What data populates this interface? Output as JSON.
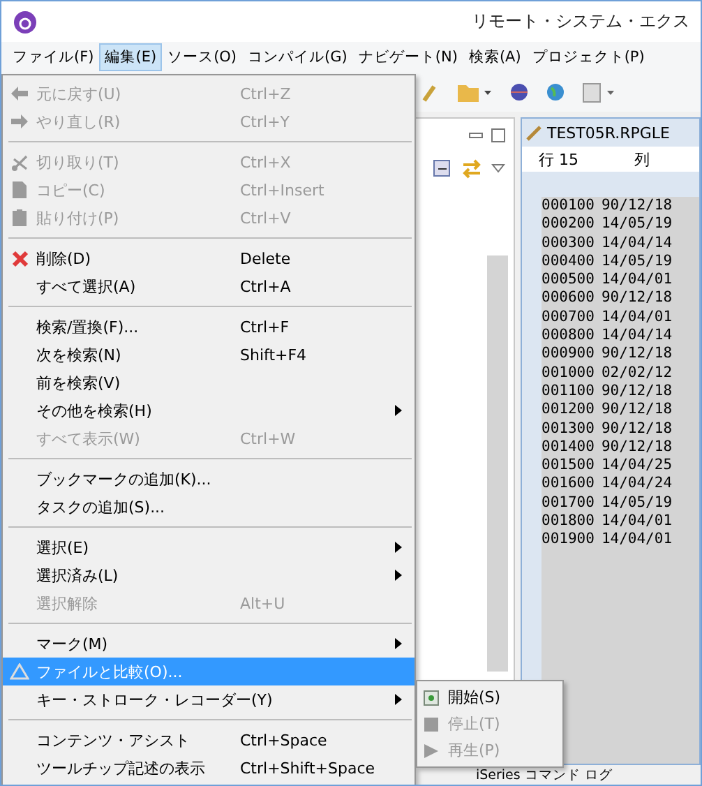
{
  "window": {
    "title": "リモート・システム・エクス"
  },
  "menubar": [
    {
      "label": "ファイル(F)",
      "selected": false
    },
    {
      "label": "編集(E)",
      "selected": true
    },
    {
      "label": "ソース(O)",
      "selected": false
    },
    {
      "label": "コンパイル(G)",
      "selected": false
    },
    {
      "label": "ナビゲート(N)",
      "selected": false
    },
    {
      "label": "検索(A)",
      "selected": false
    },
    {
      "label": "プロジェクト(P)",
      "selected": false
    }
  ],
  "edit_menu": [
    {
      "kind": "undo",
      "label": "元に戻す(U)",
      "shortcut": "Ctrl+Z",
      "disabled": true,
      "submenu": false,
      "selected": false
    },
    {
      "kind": "redo",
      "label": "やり直し(R)",
      "shortcut": "Ctrl+Y",
      "disabled": true,
      "submenu": false,
      "selected": false
    },
    {
      "kind": "separator"
    },
    {
      "kind": "cut",
      "label": "切り取り(T)",
      "shortcut": "Ctrl+X",
      "disabled": true,
      "submenu": false,
      "selected": false
    },
    {
      "kind": "copy",
      "label": "コピー(C)",
      "shortcut": "Ctrl+Insert",
      "disabled": true,
      "submenu": false,
      "selected": false
    },
    {
      "kind": "paste",
      "label": "貼り付け(P)",
      "shortcut": "Ctrl+V",
      "disabled": true,
      "submenu": false,
      "selected": false
    },
    {
      "kind": "separator"
    },
    {
      "kind": "delete",
      "label": "削除(D)",
      "shortcut": "Delete",
      "disabled": false,
      "submenu": false,
      "selected": false
    },
    {
      "kind": "item",
      "label": "すべて選択(A)",
      "shortcut": "Ctrl+A",
      "disabled": false,
      "submenu": false,
      "selected": false
    },
    {
      "kind": "separator"
    },
    {
      "kind": "item",
      "label": "検索/置換(F)...",
      "shortcut": "Ctrl+F",
      "disabled": false,
      "submenu": false,
      "selected": false
    },
    {
      "kind": "item",
      "label": "次を検索(N)",
      "shortcut": "Shift+F4",
      "disabled": false,
      "submenu": false,
      "selected": false
    },
    {
      "kind": "item",
      "label": "前を検索(V)",
      "disabled": false,
      "submenu": false,
      "selected": false
    },
    {
      "kind": "item",
      "label": "その他を検索(H)",
      "disabled": false,
      "submenu": true,
      "selected": false
    },
    {
      "kind": "item",
      "label": "すべて表示(W)",
      "shortcut": "Ctrl+W",
      "disabled": true,
      "submenu": false,
      "selected": false
    },
    {
      "kind": "separator"
    },
    {
      "kind": "item",
      "label": "ブックマークの追加(K)...",
      "disabled": false,
      "submenu": false,
      "selected": false
    },
    {
      "kind": "item",
      "label": "タスクの追加(S)...",
      "disabled": false,
      "submenu": false,
      "selected": false
    },
    {
      "kind": "separator"
    },
    {
      "kind": "item",
      "label": "選択(E)",
      "disabled": false,
      "submenu": true,
      "selected": false
    },
    {
      "kind": "item",
      "label": "選択済み(L)",
      "disabled": false,
      "submenu": true,
      "selected": false
    },
    {
      "kind": "item",
      "label": "選択解除",
      "shortcut": "Alt+U",
      "disabled": true,
      "submenu": false,
      "selected": false
    },
    {
      "kind": "separator"
    },
    {
      "kind": "item",
      "label": "マーク(M)",
      "disabled": false,
      "submenu": true,
      "selected": false
    },
    {
      "kind": "compare",
      "label": "ファイルと比較(O)...",
      "disabled": false,
      "submenu": false,
      "selected": true
    },
    {
      "kind": "item",
      "label": "キー・ストローク・レコーダー(Y)",
      "disabled": false,
      "submenu": true,
      "selected": false
    },
    {
      "kind": "separator"
    },
    {
      "kind": "item",
      "label": "コンテンツ・アシスト",
      "shortcut": "Ctrl+Space",
      "disabled": false,
      "submenu": false,
      "selected": false
    },
    {
      "kind": "item",
      "label": "ツールチップ記述の表示",
      "shortcut": "Ctrl+Shift+Space",
      "disabled": false,
      "submenu": false,
      "selected": false
    }
  ],
  "recorder_submenu": [
    {
      "kind": "record",
      "label": "開始(S)",
      "disabled": false
    },
    {
      "kind": "stop",
      "label": "停止(T)",
      "disabled": true
    },
    {
      "kind": "play",
      "label": "再生(P)",
      "disabled": true
    }
  ],
  "editor": {
    "tab": "TEST05R.RPGLE",
    "row_label": "行 15",
    "column_label": "列",
    "lines": [
      {
        "seq": "000100",
        "date": "90/12/18"
      },
      {
        "seq": "000200",
        "date": "14/05/19"
      },
      {
        "seq": "000300",
        "date": "14/04/14"
      },
      {
        "seq": "000400",
        "date": "14/05/19"
      },
      {
        "seq": "000500",
        "date": "14/04/01"
      },
      {
        "seq": "000600",
        "date": "90/12/18"
      },
      {
        "seq": "000700",
        "date": "14/04/01"
      },
      {
        "seq": "000800",
        "date": "14/04/14"
      },
      {
        "seq": "000900",
        "date": "90/12/18"
      },
      {
        "seq": "001000",
        "date": "02/02/12"
      },
      {
        "seq": "001100",
        "date": "90/12/18"
      },
      {
        "seq": "001200",
        "date": "90/12/18"
      },
      {
        "seq": "001300",
        "date": "90/12/18"
      },
      {
        "seq": "001400",
        "date": "90/12/18"
      },
      {
        "seq": "001500",
        "date": "14/04/25"
      },
      {
        "seq": "001600",
        "date": "14/04/24"
      },
      {
        "seq": "001700",
        "date": "14/05/19"
      },
      {
        "seq": "001800",
        "date": "14/04/01"
      },
      {
        "seq": "001900",
        "date": "14/04/01"
      }
    ]
  },
  "bottom_tabs": [
    "iSeries コマンド ログ"
  ]
}
